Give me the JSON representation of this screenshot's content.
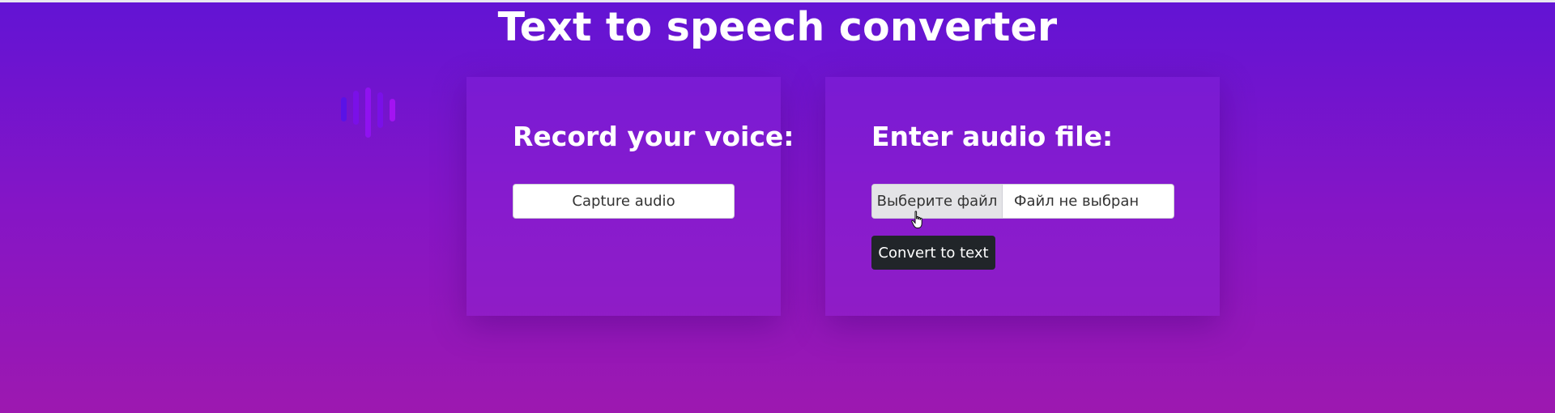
{
  "page": {
    "title": "Text to speech converter"
  },
  "record_card": {
    "heading": "Record your voice:",
    "capture_label": "Capture audio"
  },
  "file_card": {
    "heading": "Enter audio file:",
    "choose_label": "Выберите файл",
    "status_text": "Файл не выбран",
    "convert_label": "Convert to text"
  },
  "icons": {
    "wave": "audio-wave-icon",
    "cursor": "hand-pointer-icon"
  },
  "colors": {
    "background_top": "#6214d4",
    "background_bottom": "#9d18b0",
    "convert_button": "#212529",
    "wave_bars": [
      "#5a12e6",
      "#7a10e8",
      "#8f12f0",
      "#7a10e8",
      "#a313f2"
    ]
  }
}
